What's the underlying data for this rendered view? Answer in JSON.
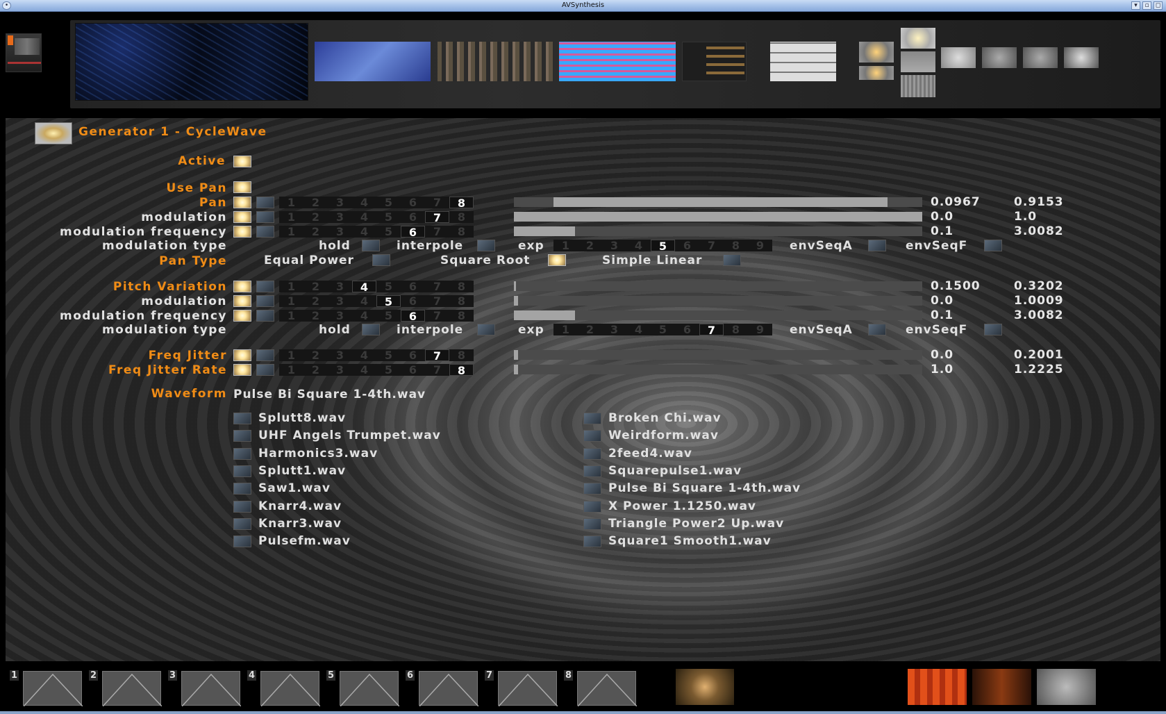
{
  "window": {
    "title": "AVSynthesis"
  },
  "header": {
    "title": "Generator 1 - CycleWave"
  },
  "labels": {
    "active": "Active",
    "use_pan": "Use Pan",
    "pan": "Pan",
    "modulation": "modulation",
    "modulation_frequency": "modulation frequency",
    "modulation_type": "modulation type",
    "pan_type": "Pan Type",
    "pitch_variation": "Pitch Variation",
    "freq_jitter": "Freq Jitter",
    "freq_jitter_rate": "Freq Jitter Rate",
    "waveform": "Waveform"
  },
  "num_buttons": [
    "1",
    "2",
    "3",
    "4",
    "5",
    "6",
    "7",
    "8"
  ],
  "exp_buttons": [
    "1",
    "2",
    "3",
    "4",
    "5",
    "6",
    "7",
    "8",
    "9"
  ],
  "mod_type_options": {
    "hold": "hold",
    "interpole": "interpole",
    "exp": "exp",
    "envSeqA": "envSeqA",
    "envSeqF": "envSeqF"
  },
  "pan_type_options": {
    "equal_power": "Equal Power",
    "square_root": "Square Root",
    "simple_linear": "Simple Linear",
    "selected": "Square Root"
  },
  "rows": {
    "pan": {
      "selected": "8",
      "min": "0.0967",
      "max": "0.9153",
      "fill_start": 0.0967,
      "fill_end": 0.9153
    },
    "pan_mod": {
      "selected": "7",
      "min": "0.0",
      "max": "1.0",
      "fill_start": 0.0,
      "fill_end": 1.0
    },
    "pan_modfreq": {
      "selected": "6",
      "min": "0.1",
      "max": "3.0082",
      "fill_start": 0.0,
      "fill_end": 0.15
    },
    "pan_modtype": {
      "selected_exp": "5"
    },
    "pitch": {
      "selected": "4",
      "min": "0.1500",
      "max": "0.3202",
      "fill_start": 0.0,
      "fill_end": 0.005
    },
    "pitch_mod": {
      "selected": "5",
      "min": "0.0",
      "max": "1.0009",
      "fill_start": 0.0,
      "fill_end": 0.01
    },
    "pitch_modfreq": {
      "selected": "6",
      "min": "0.1",
      "max": "3.0082",
      "fill_start": 0.0,
      "fill_end": 0.15
    },
    "pitch_modtype": {
      "selected_exp": "7"
    },
    "jitter": {
      "selected": "7",
      "min": "0.0",
      "max": "0.2001",
      "fill_start": 0.0,
      "fill_end": 0.01
    },
    "jitter_rate": {
      "selected": "8",
      "min": "1.0",
      "max": "1.2225",
      "fill_start": 0.0,
      "fill_end": 0.01
    }
  },
  "waveform": {
    "current": "Pulse Bi Square 1-4th.wav",
    "left": [
      "Splutt8.wav",
      "UHF Angels Trumpet.wav",
      "Harmonics3.wav",
      "Splutt1.wav",
      "Saw1.wav",
      "Knarr4.wav",
      "Knarr3.wav",
      "Pulsefm.wav"
    ],
    "right": [
      "Broken Chi.wav",
      "Weirdform.wav",
      "2feed4.wav",
      "Squarepulse1.wav",
      "Pulse Bi Square 1-4th.wav",
      "X Power 1.1250.wav",
      "Triangle Power2 Up.wav",
      "Square1 Smooth1.wav"
    ]
  },
  "bottom_slots": [
    "1",
    "2",
    "3",
    "4",
    "5",
    "6",
    "7",
    "8"
  ],
  "colors": {
    "accent": "#f08c16",
    "title_bar": "#9fbce6"
  }
}
